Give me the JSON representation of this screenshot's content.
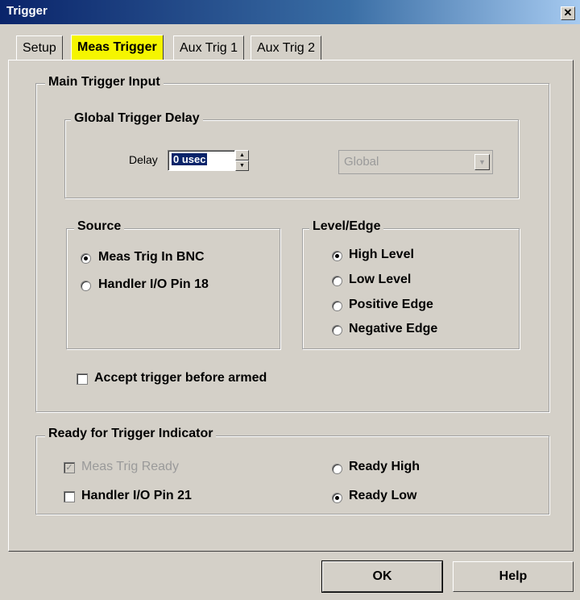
{
  "window": {
    "title": "Trigger"
  },
  "tabs": [
    "Setup",
    "Meas Trigger",
    "Aux Trig 1",
    "Aux Trig 2"
  ],
  "main_group": {
    "label": "Main Trigger Input"
  },
  "global_delay": {
    "label": "Global Trigger Delay",
    "delay_label": "Delay",
    "delay_value": "0 usec",
    "scope_value": "Global"
  },
  "source": {
    "label": "Source",
    "options": [
      "Meas Trig In BNC",
      "Handler I/O Pin 18"
    ],
    "selected": 0
  },
  "level_edge": {
    "label": "Level/Edge",
    "options": [
      "High Level",
      "Low Level",
      "Positive Edge",
      "Negative Edge"
    ],
    "selected": 0
  },
  "accept_trigger": {
    "label": "Accept trigger before armed",
    "checked": false
  },
  "ready_group": {
    "label": "Ready for Trigger Indicator",
    "meas_trig_ready": "Meas Trig Ready",
    "handler_pin": "Handler I/O Pin 21",
    "ready_high": "Ready High",
    "ready_low": "Ready Low"
  },
  "buttons": {
    "ok": "OK",
    "help": "Help"
  }
}
